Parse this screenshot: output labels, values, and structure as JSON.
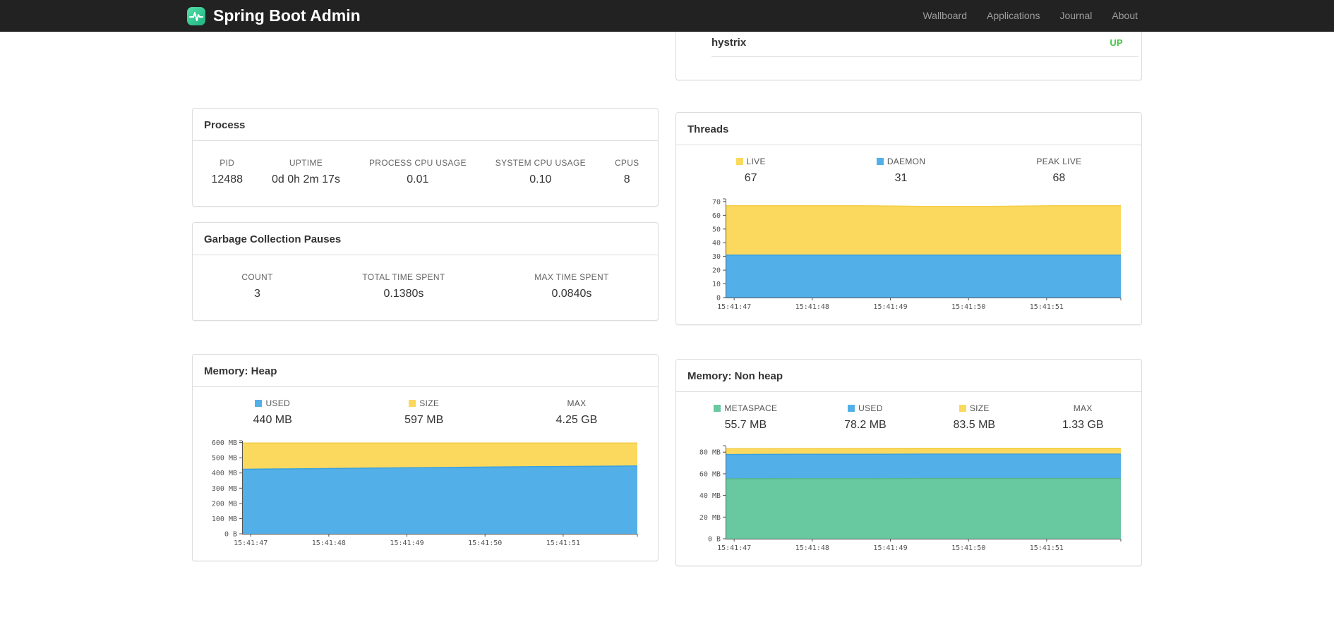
{
  "navbar": {
    "brand": "Spring Boot Admin",
    "links": [
      {
        "label": "Wallboard"
      },
      {
        "label": "Applications"
      },
      {
        "label": "Journal"
      },
      {
        "label": "About"
      }
    ]
  },
  "colors": {
    "status_up": "#42c642",
    "area_yellow": "#fbd95f",
    "area_blue": "#53afe8",
    "area_green": "#68c8a0"
  },
  "hystrix_panel": {
    "name": "hystrix",
    "status": "UP",
    "status_color": "#42c642"
  },
  "process": {
    "title": "Process",
    "metrics": [
      {
        "label": "PID",
        "value": "12488"
      },
      {
        "label": "UPTIME",
        "value": "0d 0h 2m 17s"
      },
      {
        "label": "PROCESS CPU USAGE",
        "value": "0.01"
      },
      {
        "label": "SYSTEM CPU USAGE",
        "value": "0.10"
      },
      {
        "label": "CPUS",
        "value": "8"
      }
    ]
  },
  "gc": {
    "title": "Garbage Collection Pauses",
    "metrics": [
      {
        "label": "COUNT",
        "value": "3"
      },
      {
        "label": "TOTAL TIME SPENT",
        "value": "0.1380s"
      },
      {
        "label": "MAX TIME SPENT",
        "value": "0.0840s"
      }
    ]
  },
  "threads": {
    "title": "Threads",
    "legend": [
      {
        "label": "LIVE",
        "value": "67",
        "color": "#fbd95f"
      },
      {
        "label": "DAEMON",
        "value": "31",
        "color": "#53afe8"
      },
      {
        "label": "PEAK LIVE",
        "value": "68",
        "color": null
      }
    ]
  },
  "heap": {
    "title": "Memory: Heap",
    "legend": [
      {
        "label": "USED",
        "value": "440 MB",
        "color": "#53afe8"
      },
      {
        "label": "SIZE",
        "value": "597 MB",
        "color": "#fbd95f"
      },
      {
        "label": "MAX",
        "value": "4.25 GB",
        "color": null
      }
    ]
  },
  "nonheap": {
    "title": "Memory: Non heap",
    "legend": [
      {
        "label": "METASPACE",
        "value": "55.7 MB",
        "color": "#68c8a0"
      },
      {
        "label": "USED",
        "value": "78.2 MB",
        "color": "#53afe8"
      },
      {
        "label": "SIZE",
        "value": "83.5 MB",
        "color": "#fbd95f"
      },
      {
        "label": "MAX",
        "value": "1.33 GB",
        "color": null
      }
    ]
  },
  "chart_data": [
    {
      "id": "threads-chart",
      "type": "area",
      "title": "Threads",
      "height": 168,
      "legend_position": "top",
      "grid": false,
      "x_labels": [
        "15:41:47",
        "15:41:48",
        "15:41:49",
        "15:41:50",
        "15:41:51"
      ],
      "y_ticks": [
        "0",
        "10",
        "20",
        "30",
        "40",
        "50",
        "60",
        "70"
      ],
      "y_values": [
        0,
        10,
        20,
        30,
        40,
        50,
        60,
        70
      ],
      "y_max": 72,
      "series": [
        {
          "name": "live",
          "color": "#fbd95f",
          "line": "#f3cd45",
          "points": [
            67,
            67,
            67,
            66.5,
            66.5,
            67,
            67
          ]
        },
        {
          "name": "daemon",
          "color": "#53afe8",
          "line": "#39a0e0",
          "points": [
            31,
            31,
            31,
            31,
            31,
            31,
            31
          ]
        }
      ]
    },
    {
      "id": "heap-chart",
      "type": "area",
      "title": "Memory: Heap",
      "height": 160,
      "legend_position": "top",
      "grid": false,
      "x_labels": [
        "15:41:47",
        "15:41:48",
        "15:41:49",
        "15:41:50",
        "15:41:51"
      ],
      "y_ticks": [
        "0 B",
        "100 MB",
        "200 MB",
        "300 MB",
        "400 MB",
        "500 MB",
        "600 MB"
      ],
      "y_values": [
        0,
        100,
        200,
        300,
        400,
        500,
        600
      ],
      "y_max": 612,
      "series": [
        {
          "name": "size",
          "color": "#fbd95f",
          "line": "#f3cd45",
          "points": [
            597,
            597,
            597,
            597,
            597,
            597,
            597
          ]
        },
        {
          "name": "used",
          "color": "#53afe8",
          "line": "#39a0e0",
          "points": [
            424,
            428,
            432,
            436,
            440,
            443,
            446
          ]
        }
      ]
    },
    {
      "id": "nonheap-chart",
      "type": "area",
      "title": "Memory: Non heap",
      "height": 160,
      "legend_position": "top",
      "grid": false,
      "x_labels": [
        "15:41:47",
        "15:41:48",
        "15:41:49",
        "15:41:50",
        "15:41:51"
      ],
      "y_ticks": [
        "0 B",
        "20 MB",
        "40 MB",
        "60 MB",
        "80 MB"
      ],
      "y_values": [
        0,
        20,
        40,
        60,
        80
      ],
      "y_max": 86,
      "series": [
        {
          "name": "size",
          "color": "#fbd95f",
          "line": "#f3cd45",
          "points": [
            83.2,
            83.3,
            83.4,
            83.5,
            83.5,
            83.5,
            83.5
          ]
        },
        {
          "name": "used",
          "color": "#53afe8",
          "line": "#39a0e0",
          "points": [
            77.8,
            78,
            78,
            78.2,
            78.2,
            78.2,
            78.2
          ]
        },
        {
          "name": "metaspace",
          "color": "#68c8a0",
          "line": "#54b88e",
          "points": [
            55.4,
            55.5,
            55.6,
            55.7,
            55.7,
            55.7,
            55.7
          ]
        }
      ]
    }
  ]
}
